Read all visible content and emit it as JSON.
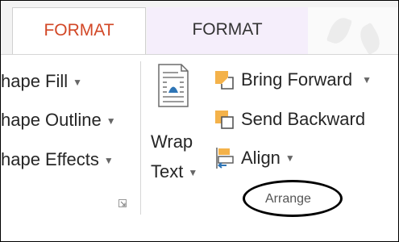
{
  "tabs": [
    {
      "label": "FORMAT",
      "color": "#d24726",
      "active": true
    },
    {
      "label": "FORMAT",
      "color": "#333333",
      "active": false
    }
  ],
  "shape_group": {
    "fill_label": "hape Fill",
    "outline_label": "hape Outline",
    "effects_label": "hape Effects"
  },
  "arrange_group": {
    "wrap_text_line1": "Wrap",
    "wrap_text_line2": "Text",
    "bring_forward_label": "Bring Forward",
    "send_backward_label": "Send Backward",
    "align_label": "Align",
    "group_label": "Arrange"
  },
  "colors": {
    "accent_tab": "#d24726",
    "icon_orange": "#f4b24a",
    "icon_blue": "#2e75b6",
    "highlight_oval": "#000000"
  },
  "icons": {
    "dropdown": "caret-down-icon",
    "launcher": "dialog-launcher-icon",
    "wrap_text": "wrap-text-icon",
    "bring_forward": "bring-forward-icon",
    "send_backward": "send-backward-icon",
    "align": "align-icon"
  }
}
